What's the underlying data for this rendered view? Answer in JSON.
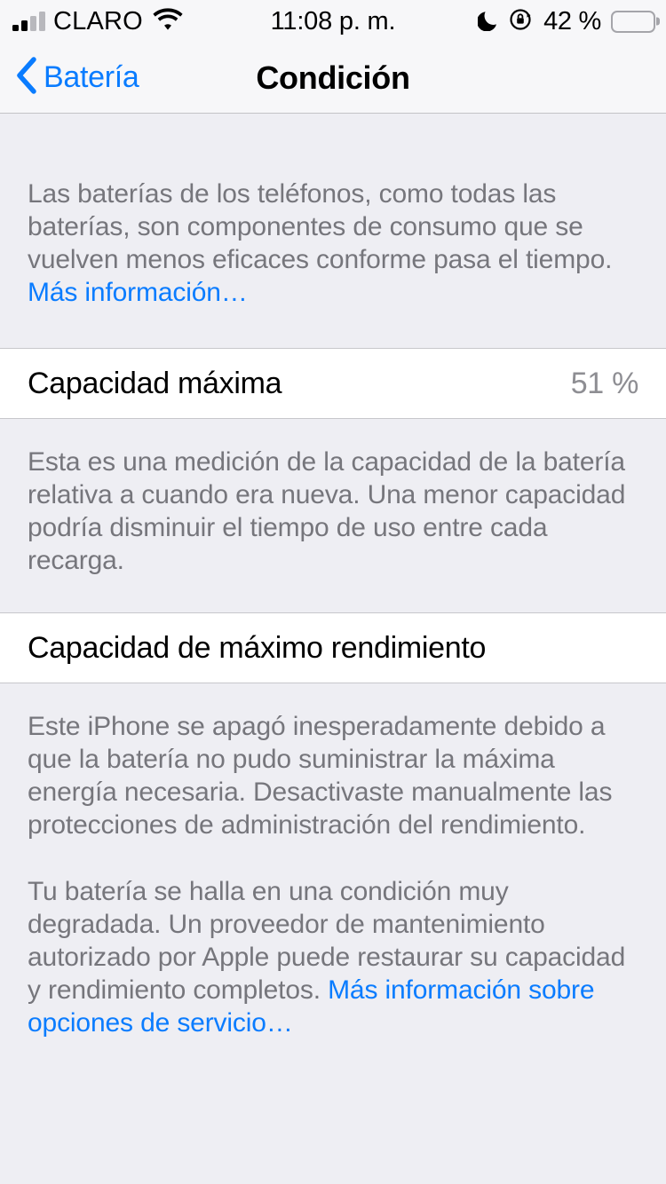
{
  "status_bar": {
    "carrier": "CLARO",
    "signal_icon": "signal-bars-icon",
    "wifi_icon": "wifi-icon",
    "time": "11:08 p. m.",
    "do_not_disturb_icon": "moon-icon",
    "rotation_lock_icon": "rotation-lock-icon",
    "battery_percent": "42 %",
    "battery_icon": "battery-icon",
    "battery_level": 42,
    "battery_color": "#fdc60b"
  },
  "nav": {
    "back_label": "Batería",
    "back_icon": "chevron-left-icon",
    "title": "Condición",
    "accent_color": "#0a7cff"
  },
  "intro": {
    "text": "Las baterías de los teléfonos, como todas las baterías, son componentes de consumo que se vuelven menos eficaces conforme pasa el tiempo. ",
    "link": "Más información…"
  },
  "max_capacity": {
    "label": "Capacidad máxima",
    "value": "51 %",
    "note": "Esta es una medición de la capacidad de la batería relativa a cuando era nueva. Una menor capacidad podría disminuir el tiempo de uso entre cada recarga."
  },
  "peak_performance": {
    "label": "Capacidad de máximo rendimiento",
    "note_paragraph_1": "Este iPhone se apagó inesperadamente debido a que la batería no pudo suministrar la máxima energía necesaria. Desactivaste manualmente las protecciones de administración del rendimiento.",
    "note_paragraph_2": "Tu batería se halla en una condición muy degradada. Un proveedor de mantenimiento autorizado por Apple puede restaurar su capacidad y rendimiento completos. ",
    "service_link": "Más información sobre opciones de servicio…"
  }
}
